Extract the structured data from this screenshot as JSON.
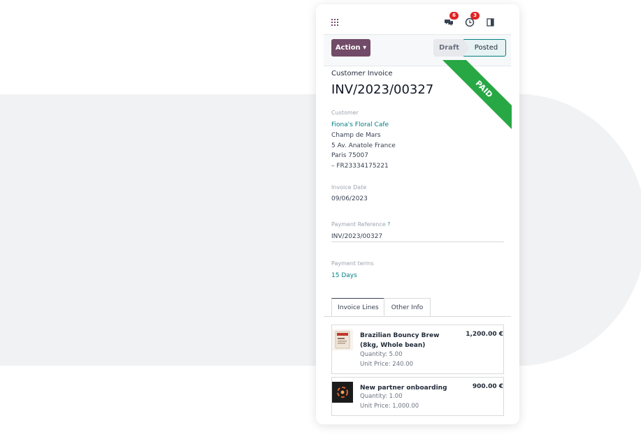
{
  "navbar": {
    "chat_badge": "6",
    "activity_badge": "3",
    "icons": [
      "apps-grid-icon",
      "chat-icon",
      "clock-icon",
      "side-panel-icon"
    ]
  },
  "control_panel": {
    "action_label": "Action ▾",
    "status_steps": [
      "Draft",
      "Posted"
    ],
    "active_status": "Posted"
  },
  "ribbon": {
    "text": "PAID",
    "color": "#28a745"
  },
  "invoice": {
    "subtitle": "Customer Invoice",
    "number": "INV/2023/00327",
    "customer_label": "Customer",
    "customer_name": "Fiona's Floral Cafe",
    "address_lines": [
      "Champ de Mars",
      "5 Av. Anatole France",
      "Paris 75007",
      "– FR23334175221"
    ],
    "invoice_date_label": "Invoice Date",
    "invoice_date": "09/06/2023",
    "payment_ref_label": "Payment Reference",
    "payment_ref_help": "?",
    "payment_ref": "INV/2023/00327",
    "payment_terms_label": "Payment terms",
    "payment_terms": "15 Days"
  },
  "tabs": [
    {
      "label": "Invoice Lines",
      "active": true
    },
    {
      "label": "Other Info",
      "active": false
    }
  ],
  "lines": [
    {
      "name": "Brazilian Bouncy Brew (8kg, Whole bean)",
      "price": "1,200.00 €",
      "quantity": "Quantity: 5.00",
      "unit_price": "Unit Price: 240.00"
    },
    {
      "name": "New partner onboarding",
      "price": "900.00 €",
      "quantity": "Quantity: 1.00",
      "unit_price": "Unit Price: 1,000.00"
    }
  ],
  "colors": {
    "brand": "#714b67",
    "link": "#017e84",
    "badge": "#e02424"
  }
}
